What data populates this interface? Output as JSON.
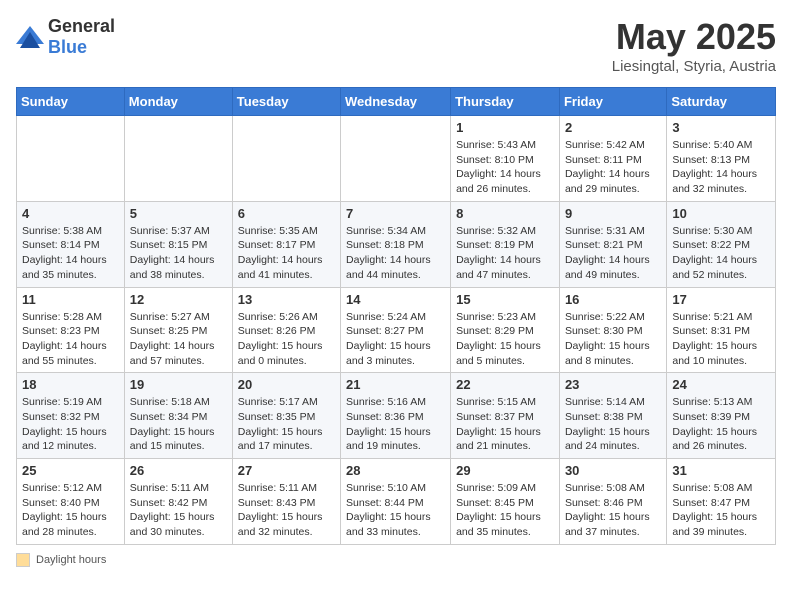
{
  "header": {
    "logo_general": "General",
    "logo_blue": "Blue",
    "title": "May 2025",
    "location": "Liesingtal, Styria, Austria"
  },
  "days_of_week": [
    "Sunday",
    "Monday",
    "Tuesday",
    "Wednesday",
    "Thursday",
    "Friday",
    "Saturday"
  ],
  "weeks": [
    [
      {
        "day": "",
        "info": ""
      },
      {
        "day": "",
        "info": ""
      },
      {
        "day": "",
        "info": ""
      },
      {
        "day": "",
        "info": ""
      },
      {
        "day": "1",
        "info": "Sunrise: 5:43 AM\nSunset: 8:10 PM\nDaylight: 14 hours and 26 minutes."
      },
      {
        "day": "2",
        "info": "Sunrise: 5:42 AM\nSunset: 8:11 PM\nDaylight: 14 hours and 29 minutes."
      },
      {
        "day": "3",
        "info": "Sunrise: 5:40 AM\nSunset: 8:13 PM\nDaylight: 14 hours and 32 minutes."
      }
    ],
    [
      {
        "day": "4",
        "info": "Sunrise: 5:38 AM\nSunset: 8:14 PM\nDaylight: 14 hours and 35 minutes."
      },
      {
        "day": "5",
        "info": "Sunrise: 5:37 AM\nSunset: 8:15 PM\nDaylight: 14 hours and 38 minutes."
      },
      {
        "day": "6",
        "info": "Sunrise: 5:35 AM\nSunset: 8:17 PM\nDaylight: 14 hours and 41 minutes."
      },
      {
        "day": "7",
        "info": "Sunrise: 5:34 AM\nSunset: 8:18 PM\nDaylight: 14 hours and 44 minutes."
      },
      {
        "day": "8",
        "info": "Sunrise: 5:32 AM\nSunset: 8:19 PM\nDaylight: 14 hours and 47 minutes."
      },
      {
        "day": "9",
        "info": "Sunrise: 5:31 AM\nSunset: 8:21 PM\nDaylight: 14 hours and 49 minutes."
      },
      {
        "day": "10",
        "info": "Sunrise: 5:30 AM\nSunset: 8:22 PM\nDaylight: 14 hours and 52 minutes."
      }
    ],
    [
      {
        "day": "11",
        "info": "Sunrise: 5:28 AM\nSunset: 8:23 PM\nDaylight: 14 hours and 55 minutes."
      },
      {
        "day": "12",
        "info": "Sunrise: 5:27 AM\nSunset: 8:25 PM\nDaylight: 14 hours and 57 minutes."
      },
      {
        "day": "13",
        "info": "Sunrise: 5:26 AM\nSunset: 8:26 PM\nDaylight: 15 hours and 0 minutes."
      },
      {
        "day": "14",
        "info": "Sunrise: 5:24 AM\nSunset: 8:27 PM\nDaylight: 15 hours and 3 minutes."
      },
      {
        "day": "15",
        "info": "Sunrise: 5:23 AM\nSunset: 8:29 PM\nDaylight: 15 hours and 5 minutes."
      },
      {
        "day": "16",
        "info": "Sunrise: 5:22 AM\nSunset: 8:30 PM\nDaylight: 15 hours and 8 minutes."
      },
      {
        "day": "17",
        "info": "Sunrise: 5:21 AM\nSunset: 8:31 PM\nDaylight: 15 hours and 10 minutes."
      }
    ],
    [
      {
        "day": "18",
        "info": "Sunrise: 5:19 AM\nSunset: 8:32 PM\nDaylight: 15 hours and 12 minutes."
      },
      {
        "day": "19",
        "info": "Sunrise: 5:18 AM\nSunset: 8:34 PM\nDaylight: 15 hours and 15 minutes."
      },
      {
        "day": "20",
        "info": "Sunrise: 5:17 AM\nSunset: 8:35 PM\nDaylight: 15 hours and 17 minutes."
      },
      {
        "day": "21",
        "info": "Sunrise: 5:16 AM\nSunset: 8:36 PM\nDaylight: 15 hours and 19 minutes."
      },
      {
        "day": "22",
        "info": "Sunrise: 5:15 AM\nSunset: 8:37 PM\nDaylight: 15 hours and 21 minutes."
      },
      {
        "day": "23",
        "info": "Sunrise: 5:14 AM\nSunset: 8:38 PM\nDaylight: 15 hours and 24 minutes."
      },
      {
        "day": "24",
        "info": "Sunrise: 5:13 AM\nSunset: 8:39 PM\nDaylight: 15 hours and 26 minutes."
      }
    ],
    [
      {
        "day": "25",
        "info": "Sunrise: 5:12 AM\nSunset: 8:40 PM\nDaylight: 15 hours and 28 minutes."
      },
      {
        "day": "26",
        "info": "Sunrise: 5:11 AM\nSunset: 8:42 PM\nDaylight: 15 hours and 30 minutes."
      },
      {
        "day": "27",
        "info": "Sunrise: 5:11 AM\nSunset: 8:43 PM\nDaylight: 15 hours and 32 minutes."
      },
      {
        "day": "28",
        "info": "Sunrise: 5:10 AM\nSunset: 8:44 PM\nDaylight: 15 hours and 33 minutes."
      },
      {
        "day": "29",
        "info": "Sunrise: 5:09 AM\nSunset: 8:45 PM\nDaylight: 15 hours and 35 minutes."
      },
      {
        "day": "30",
        "info": "Sunrise: 5:08 AM\nSunset: 8:46 PM\nDaylight: 15 hours and 37 minutes."
      },
      {
        "day": "31",
        "info": "Sunrise: 5:08 AM\nSunset: 8:47 PM\nDaylight: 15 hours and 39 minutes."
      }
    ]
  ],
  "legend": {
    "daylight_label": "Daylight hours"
  }
}
